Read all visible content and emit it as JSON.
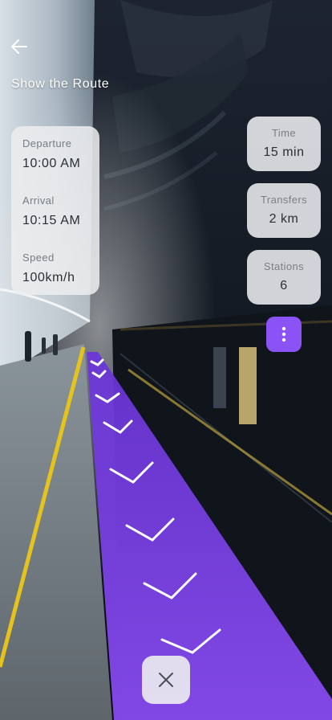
{
  "header": {
    "title": "Show the Route"
  },
  "trip": {
    "departure_label": "Departure",
    "departure_value": "10:00 AM",
    "arrival_label": "Arrival",
    "arrival_value": "10:15 AM",
    "speed_label": "Speed",
    "speed_value": "100km/h"
  },
  "stats": [
    {
      "label": "Time",
      "value": "15 min"
    },
    {
      "label": "Transfers",
      "value": "2 km"
    },
    {
      "label": "Stations",
      "value": "6"
    }
  ],
  "icons": {
    "back": "arrow-left-icon",
    "more": "more-vertical-icon",
    "close": "close-icon"
  },
  "colors": {
    "accent": "#8b52f5",
    "route_overlay": "#7c3cf0",
    "card_bg": "#eceded",
    "platform_edge": "#e6c31c"
  }
}
